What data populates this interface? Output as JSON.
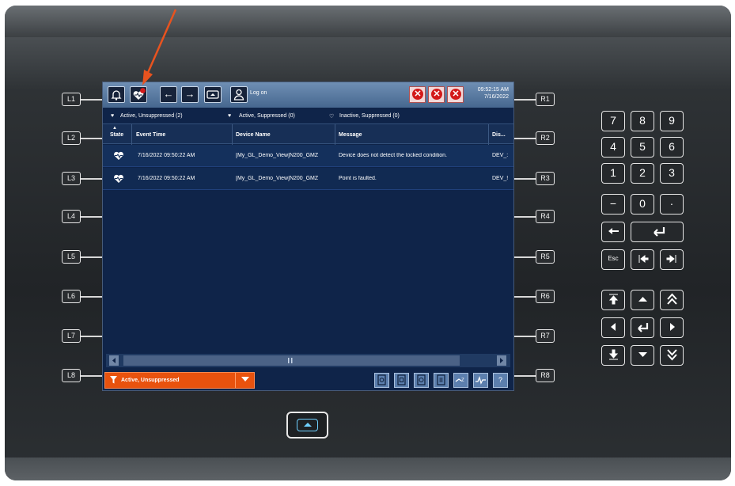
{
  "softkeys_left": [
    "L1",
    "L2",
    "L3",
    "L4",
    "L5",
    "L6",
    "L7",
    "L8"
  ],
  "softkeys_right": [
    "R1",
    "R2",
    "R3",
    "R4",
    "R5",
    "R6",
    "R7",
    "R8"
  ],
  "toolbar": {
    "bell_icon": "bell-icon",
    "alarm_badge_icon": "heart-alarm-icon",
    "back_label": "←",
    "forward_label": "→",
    "screen_icon": "screen-icon",
    "user_icon": "user-icon",
    "logon_label": "Log on",
    "clock_time": "09:52:15 AM",
    "clock_date": "7/16/2022"
  },
  "filters": [
    "Active, Unsuppressed (2)",
    "Active, Suppressed (0)",
    "Inactive, Suppressed (0)"
  ],
  "table": {
    "columns": [
      "State",
      "Event Time",
      "Device Name",
      "Message",
      "Dis..."
    ],
    "rows": [
      {
        "state_icon": "heart-alarm-icon",
        "event_time": "7/16/2022 09:50:22 AM",
        "device_name": "[My_GL_Demo_View]N200_GMZ",
        "message": "Device does not detect the locked condition.",
        "display": "DEV_:"
      },
      {
        "state_icon": "heart-alarm-icon",
        "event_time": "7/16/2022 09:50:22 AM",
        "device_name": "[My_GL_Demo_View]N200_GMZ",
        "message": "Point is faulted.",
        "display": "DEV_!"
      }
    ]
  },
  "bottom": {
    "filter_label": "Active, Unsuppressed",
    "help_label": "?"
  },
  "keypad": {
    "digits": [
      "7",
      "8",
      "9",
      "4",
      "5",
      "6",
      "1",
      "2",
      "3",
      "−",
      "0",
      "·"
    ],
    "esc_label": "Esc"
  },
  "colors": {
    "accent_orange": "#e8520e",
    "screen_bg": "#0f2449",
    "toolbar_bg": "#5a7ca3",
    "alarm_red": "#d31a1a"
  }
}
